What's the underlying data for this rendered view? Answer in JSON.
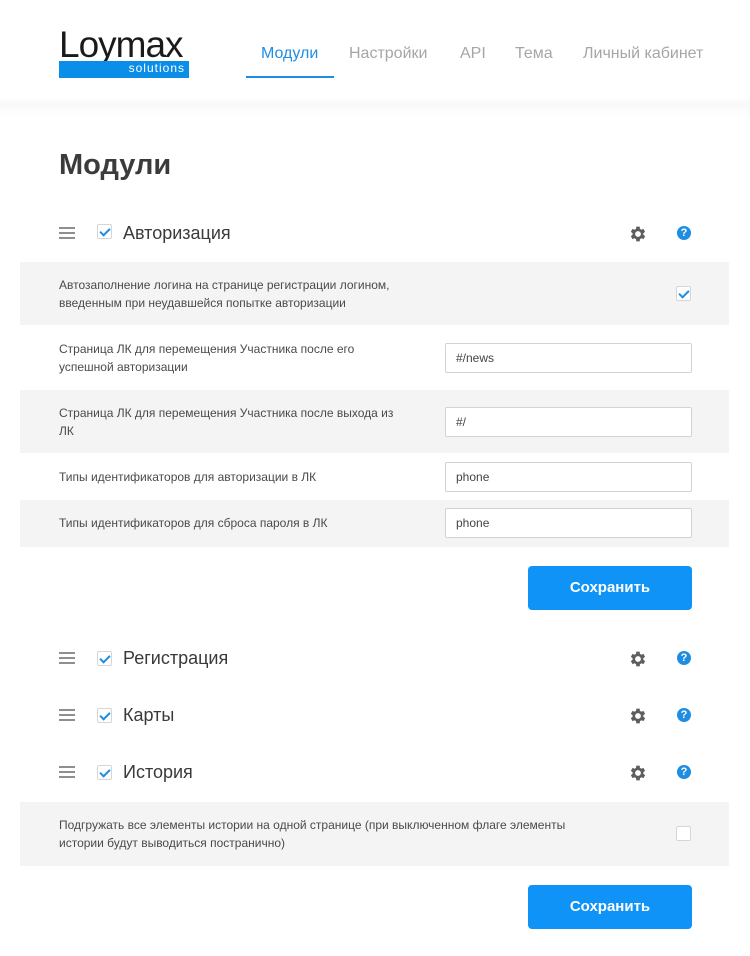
{
  "logo": {
    "word": "Loymax",
    "sub": "solutions"
  },
  "nav": [
    {
      "label": "Модули",
      "active": true
    },
    {
      "label": "Настройки"
    },
    {
      "label": "API"
    },
    {
      "label": "Тема"
    },
    {
      "label": "Личный кабинет"
    }
  ],
  "page_title": "Модули",
  "help_glyph": "?",
  "modules": {
    "auth": {
      "title": "Авторизация",
      "enabled": true,
      "settings": {
        "autofill_label": "Автозаполнение логина на странице регистрации логином, введенным при неудавшейся попытке авторизации",
        "autofill_checked": true,
        "redirect_login_label": "Страница ЛК для перемещения Участника после его успешной авторизации",
        "redirect_login_value": "#/news",
        "redirect_logout_label": "Страница ЛК для перемещения Участника после выхода из ЛК",
        "redirect_logout_value": "#/",
        "id_types_auth_label": "Типы идентификаторов для авторизации в ЛК",
        "id_types_auth_value": "phone",
        "id_types_reset_label": "Типы идентификаторов для сброса пароля в ЛК",
        "id_types_reset_value": "phone"
      },
      "save_label": "Сохранить"
    },
    "registration": {
      "title": "Регистрация",
      "enabled": true
    },
    "cards": {
      "title": "Карты",
      "enabled": true
    },
    "history": {
      "title": "История",
      "enabled": true,
      "settings": {
        "load_all_label": "Подгружать все элементы истории на одной странице (при выключенном флаге элементы истории будут выводиться постранично)",
        "load_all_checked": false
      },
      "save_label": "Сохранить"
    }
  },
  "colors": {
    "accent": "#1f8ee0",
    "button": "#0f93f7",
    "row_grey": "#f4f4f4"
  }
}
